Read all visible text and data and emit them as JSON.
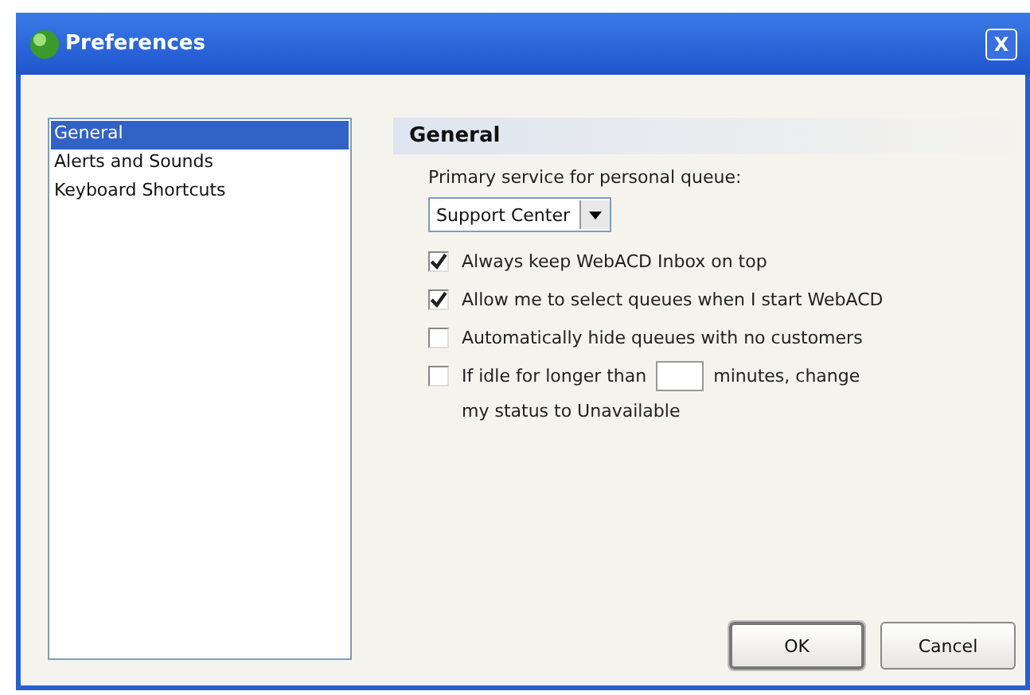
{
  "window": {
    "title": "Preferences",
    "close": "X"
  },
  "sidebar": {
    "items": [
      {
        "label": "General",
        "selected": true
      },
      {
        "label": "Alerts and Sounds",
        "selected": false
      },
      {
        "label": "Keyboard Shortcuts",
        "selected": false
      }
    ]
  },
  "panel": {
    "heading": "General",
    "service_label": "Primary service for personal queue:",
    "service_value": "Support Center",
    "options": [
      {
        "kind": "plain",
        "label": "Always keep WebACD Inbox on top",
        "checked": true
      },
      {
        "kind": "plain",
        "label": "Allow me to select queues when I start WebACD",
        "checked": true
      },
      {
        "kind": "plain",
        "label": "Automatically hide queues with no customers",
        "checked": false
      },
      {
        "kind": "idle",
        "label": "If idle for longer than",
        "label_after": "minutes, change",
        "label_continued": "my status to Unavailable",
        "checked": false
      }
    ]
  },
  "buttons": [
    {
      "label": "OK",
      "default": true
    },
    {
      "label": "Cancel",
      "default": false
    }
  ]
}
